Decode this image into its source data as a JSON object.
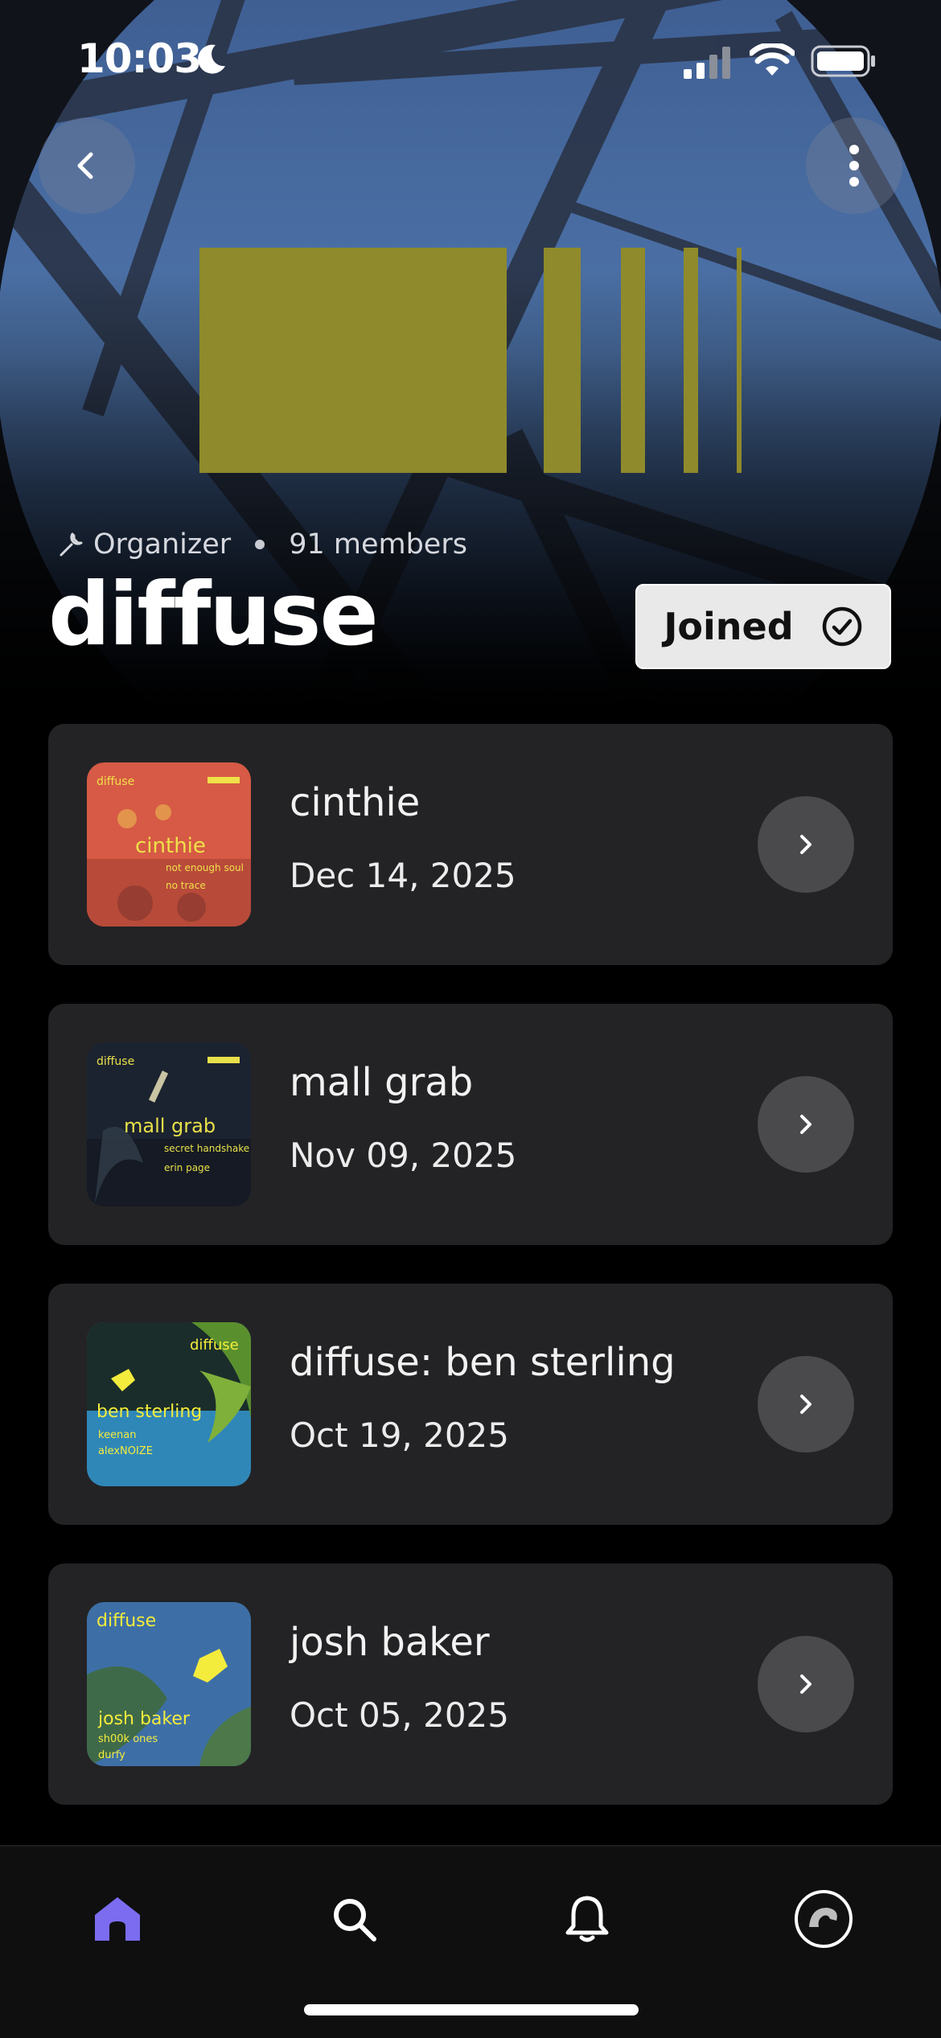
{
  "status_bar": {
    "time": "10:03",
    "icons": [
      "moon-icon",
      "cellular-signal-icon",
      "wifi-icon",
      "battery-icon"
    ]
  },
  "header": {
    "back_icon": "chevron-left-icon",
    "more_icon": "vertical-ellipsis-icon",
    "logo": "diffuse-barcode-logo",
    "logo_color": "#8f8a2b",
    "role_icon": "wrench-icon",
    "role": "Organizer",
    "members": "91 members",
    "title": "diffuse",
    "joined_label": "Joined",
    "joined_icon": "check-circle-icon"
  },
  "events": [
    {
      "name": "cinthie",
      "date": "Dec 14, 2025",
      "poster": {
        "brand": "diffuse",
        "headline": "cinthie",
        "lines": [
          "not enough soul",
          "no trace"
        ],
        "bg": "#d65a45",
        "text_color": "#f0e04a"
      }
    },
    {
      "name": "mall grab",
      "date": "Nov 09, 2025",
      "poster": {
        "brand": "diffuse",
        "headline": "mall grab",
        "lines": [
          "secret handshake",
          "erin page"
        ],
        "bg": "#1c2330",
        "text_color": "#e8e04a"
      }
    },
    {
      "name": "diffuse: ben sterling",
      "date": "Oct 19, 2025",
      "poster": {
        "brand": "diffuse",
        "headline": "ben sterling",
        "lines": [
          "keenan",
          "alexNOIZE"
        ],
        "bg": "#2f87b8",
        "text_color": "#f4ec3c"
      }
    },
    {
      "name": "josh baker",
      "date": "Oct 05, 2025",
      "poster": {
        "brand": "diffuse",
        "headline": "josh baker",
        "lines": [
          "sh00k ones",
          "durfy"
        ],
        "bg": "#3d6fa6",
        "text_color": "#f4ec3c"
      }
    }
  ],
  "tab_bar": {
    "items": [
      {
        "id": "home",
        "icon": "home-icon",
        "active": true
      },
      {
        "id": "search",
        "icon": "search-icon",
        "active": false
      },
      {
        "id": "notifications",
        "icon": "bell-icon",
        "active": false
      },
      {
        "id": "profile",
        "icon": "profile-avatar-icon",
        "active": false
      }
    ],
    "active_color": "#7b6cf0"
  }
}
